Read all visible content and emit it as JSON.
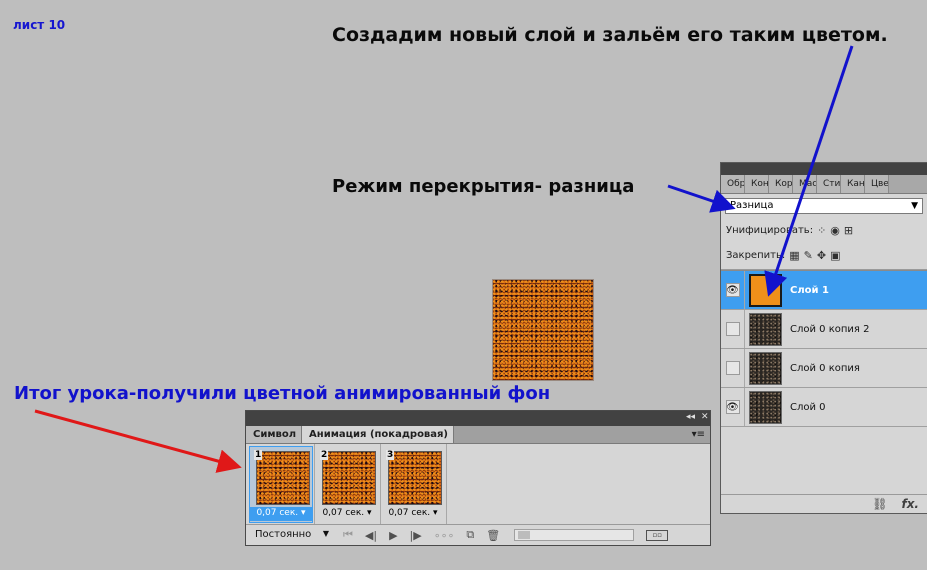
{
  "sheet_label": "лист 10",
  "captions": {
    "new_layer": "Создадим новый слой и зальём его таким цветом.",
    "blend_mode": "Режим перекрытия- разница",
    "result": "Итог урока-получили цветной анимированный фон"
  },
  "colors": {
    "annotation_blue": "#1212cc",
    "arrow_red": "#e01818",
    "selection_blue": "#3e9ef0",
    "fill_orange": "#f0901a"
  },
  "layers_panel": {
    "tabs": [
      "Обра",
      "Конт",
      "Корр",
      "Маск",
      "Стил",
      "Кана",
      "Цве"
    ],
    "blend_mode": "Разница",
    "unify_label": "Унифицировать:",
    "lock_label": "Закрепить:",
    "layers": [
      {
        "name": "Слой 1",
        "visible": true,
        "selected": true,
        "thumb": "orange"
      },
      {
        "name": "Слой 0 копия 2",
        "visible": false,
        "selected": false,
        "thumb": "noise"
      },
      {
        "name": "Слой 0 копия",
        "visible": false,
        "selected": false,
        "thumb": "noise"
      },
      {
        "name": "Слой 0",
        "visible": true,
        "selected": false,
        "thumb": "noise"
      }
    ],
    "bottom_icons": [
      "link-icon",
      "fx-icon"
    ],
    "fx_label": "fx."
  },
  "animation_panel": {
    "tab_symbol": "Символ",
    "tab_animation": "Анимация (покадровая)",
    "frames": [
      {
        "number": "1",
        "time": "0,07 сек.",
        "selected": true
      },
      {
        "number": "2",
        "time": "0,07 сек.",
        "selected": false
      },
      {
        "number": "3",
        "time": "0,07 сек.",
        "selected": false
      }
    ],
    "loop_option": "Постоянно"
  }
}
